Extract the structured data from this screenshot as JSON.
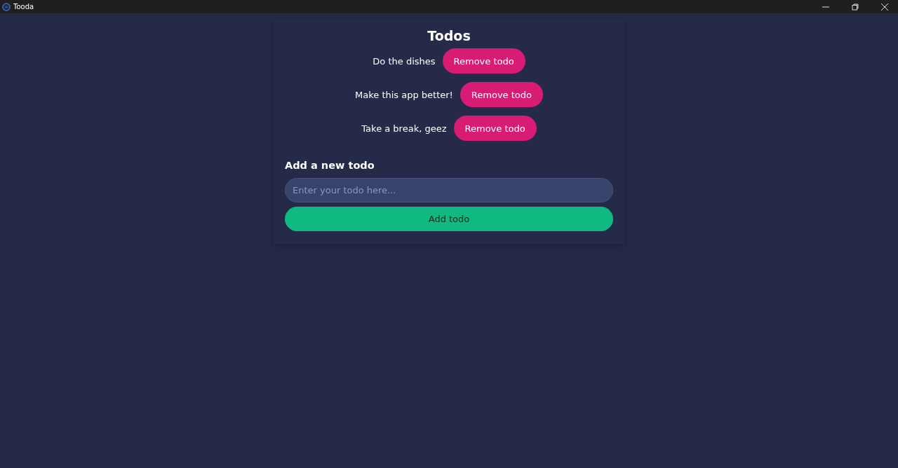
{
  "window": {
    "title": "Tooda"
  },
  "heading": "Todos",
  "todos": [
    {
      "text": "Do the dishes",
      "remove_label": "Remove todo"
    },
    {
      "text": "Make this app better!",
      "remove_label": "Remove todo"
    },
    {
      "text": "Take a break, geez",
      "remove_label": "Remove todo"
    }
  ],
  "add_form": {
    "title": "Add a new todo",
    "placeholder": "Enter your todo here...",
    "button": "Add todo"
  }
}
